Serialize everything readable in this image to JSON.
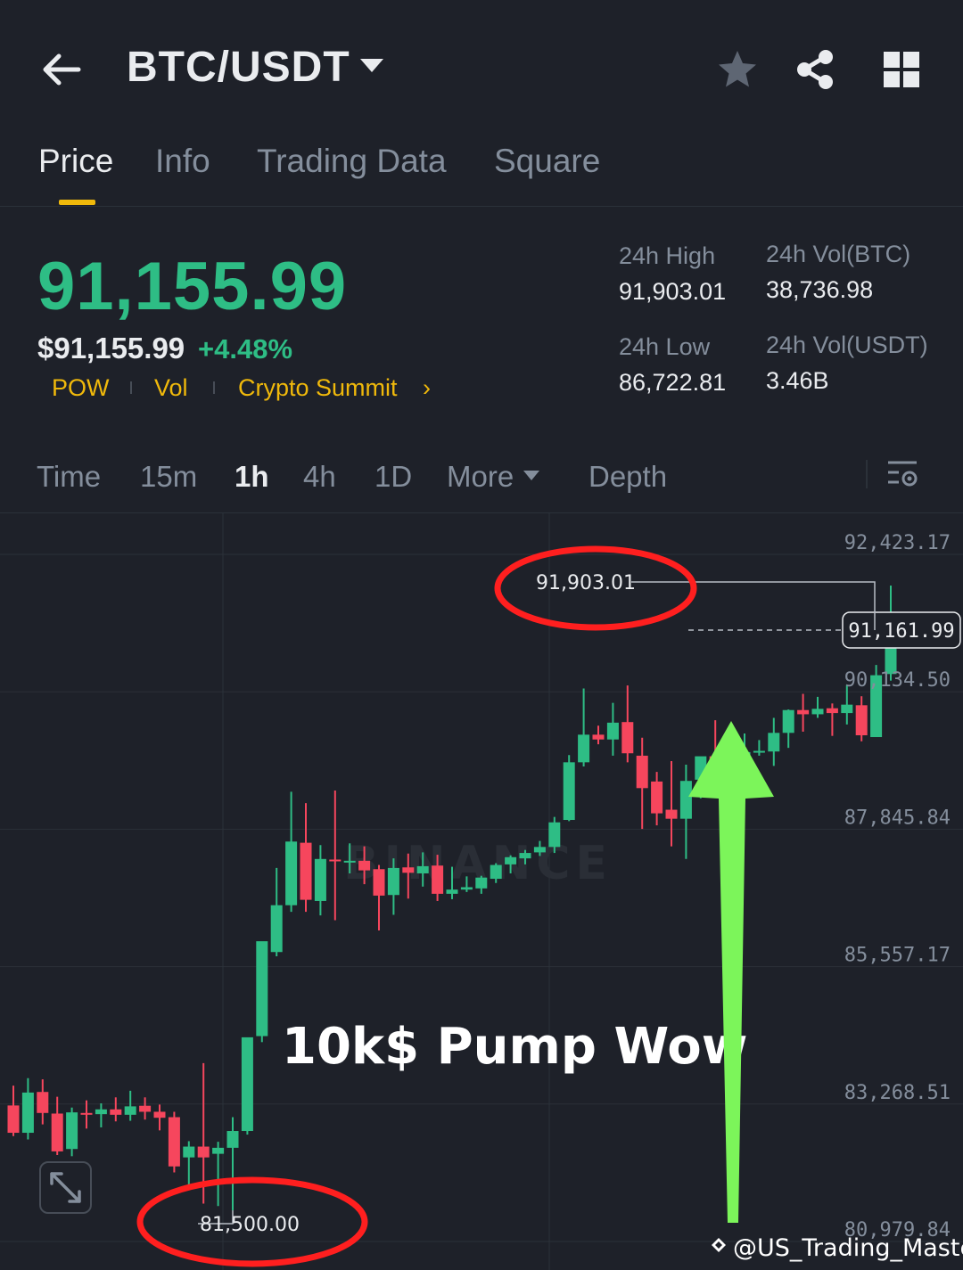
{
  "header": {
    "title": "BTC/USDT"
  },
  "tabs": [
    {
      "label": "Price",
      "active": true
    },
    {
      "label": "Info",
      "active": false
    },
    {
      "label": "Trading Data",
      "active": false
    },
    {
      "label": "Square",
      "active": false
    }
  ],
  "ticker": {
    "last_price": "91,155.99",
    "usd_price": "$91,155.99",
    "change_pct": "+4.48%",
    "tags": [
      "POW",
      "Vol",
      "Crypto Summit"
    ],
    "stats": {
      "high_label": "24h High",
      "high_value": "91,903.01",
      "low_label": "24h Low",
      "low_value": "86,722.81",
      "vol_btc_label": "24h Vol(BTC)",
      "vol_btc_value": "38,736.98",
      "vol_usdt_label": "24h Vol(USDT)",
      "vol_usdt_value": "3.46B"
    }
  },
  "intervals": {
    "items": [
      "Time",
      "15m",
      "1h",
      "4h",
      "1D"
    ],
    "active": "1h",
    "more_label": "More",
    "depth_label": "Depth"
  },
  "colors": {
    "up": "#2ebd85",
    "down": "#f6465d",
    "accent": "#f0b90b",
    "annotation_ring": "#ff1f1f",
    "arrow": "#7cf55a",
    "background": "#1e2129"
  },
  "icons": [
    "back-arrow-icon",
    "dropdown-caret-icon",
    "star-icon",
    "share-icon",
    "grid-icon",
    "chevron-right-icon",
    "chart-settings-icon",
    "expand-icon"
  ],
  "chart_data": {
    "type": "candlestick",
    "interval": "1h",
    "y_axis_ticks": [
      "92,423.17",
      "90,134.50",
      "87,845.84",
      "85,557.17",
      "83,268.51",
      "80,979.84"
    ],
    "ylim": [
      80979.84,
      92423.17
    ],
    "current_price_label": "91,161.99",
    "high_marker": "91,903.01",
    "low_marker": "81,500.00",
    "watermark": "BINANCE",
    "annotation_text": "10k$ Pump Wow",
    "credit": "@US_Trading_Master",
    "candles": [
      {
        "o": 83245,
        "h": 83575,
        "l": 82735,
        "c": 82790
      },
      {
        "o": 82790,
        "h": 83700,
        "l": 82680,
        "c": 83460
      },
      {
        "o": 83470,
        "h": 83680,
        "l": 82930,
        "c": 83120
      },
      {
        "o": 83110,
        "h": 83390,
        "l": 82420,
        "c": 82480
      },
      {
        "o": 82520,
        "h": 83210,
        "l": 82400,
        "c": 83130
      },
      {
        "o": 83120,
        "h": 83330,
        "l": 82860,
        "c": 83100
      },
      {
        "o": 83100,
        "h": 83280,
        "l": 82880,
        "c": 83180
      },
      {
        "o": 83180,
        "h": 83380,
        "l": 82980,
        "c": 83090
      },
      {
        "o": 83090,
        "h": 83490,
        "l": 82990,
        "c": 83230
      },
      {
        "o": 83240,
        "h": 83380,
        "l": 83010,
        "c": 83140
      },
      {
        "o": 83140,
        "h": 83260,
        "l": 82830,
        "c": 83040
      },
      {
        "o": 83050,
        "h": 83140,
        "l": 82130,
        "c": 82230
      },
      {
        "o": 82380,
        "h": 82650,
        "l": 81890,
        "c": 82560
      },
      {
        "o": 82560,
        "h": 83950,
        "l": 81610,
        "c": 82380
      },
      {
        "o": 82440,
        "h": 82640,
        "l": 81570,
        "c": 82540
      },
      {
        "o": 82540,
        "h": 83050,
        "l": 81500,
        "c": 82820
      },
      {
        "o": 82820,
        "h": 83200,
        "l": 82760,
        "c": 84380
      },
      {
        "o": 84400,
        "h": 84520,
        "l": 84300,
        "c": 85980
      },
      {
        "o": 85800,
        "h": 87200,
        "l": 85730,
        "c": 86580
      },
      {
        "o": 86580,
        "h": 88470,
        "l": 86470,
        "c": 87640
      },
      {
        "o": 87620,
        "h": 88280,
        "l": 86470,
        "c": 86670
      },
      {
        "o": 86650,
        "h": 87580,
        "l": 86410,
        "c": 87350
      },
      {
        "o": 87340,
        "h": 88490,
        "l": 86330,
        "c": 87310
      },
      {
        "o": 87310,
        "h": 87610,
        "l": 87110,
        "c": 87320
      },
      {
        "o": 87320,
        "h": 87560,
        "l": 86930,
        "c": 87160
      },
      {
        "o": 87180,
        "h": 87250,
        "l": 86160,
        "c": 86740
      },
      {
        "o": 86750,
        "h": 87360,
        "l": 86420,
        "c": 87200
      },
      {
        "o": 87210,
        "h": 87440,
        "l": 86690,
        "c": 87120
      },
      {
        "o": 87110,
        "h": 87460,
        "l": 86890,
        "c": 87230
      },
      {
        "o": 87240,
        "h": 87420,
        "l": 86650,
        "c": 86770
      },
      {
        "o": 86770,
        "h": 87220,
        "l": 86680,
        "c": 86840
      },
      {
        "o": 86840,
        "h": 87060,
        "l": 86800,
        "c": 86880
      },
      {
        "o": 86860,
        "h": 87070,
        "l": 86770,
        "c": 87040
      },
      {
        "o": 87020,
        "h": 87280,
        "l": 86950,
        "c": 87250
      },
      {
        "o": 87260,
        "h": 87410,
        "l": 87110,
        "c": 87380
      },
      {
        "o": 87360,
        "h": 87500,
        "l": 87260,
        "c": 87450
      },
      {
        "o": 87460,
        "h": 87650,
        "l": 87400,
        "c": 87550
      },
      {
        "o": 87550,
        "h": 88050,
        "l": 87450,
        "c": 87960
      },
      {
        "o": 88000,
        "h": 89080,
        "l": 87980,
        "c": 88960
      },
      {
        "o": 88960,
        "h": 90190,
        "l": 88890,
        "c": 89420
      },
      {
        "o": 89420,
        "h": 89570,
        "l": 89260,
        "c": 89340
      },
      {
        "o": 89340,
        "h": 89950,
        "l": 89070,
        "c": 89620
      },
      {
        "o": 89630,
        "h": 90240,
        "l": 88960,
        "c": 89110
      },
      {
        "o": 89070,
        "h": 89370,
        "l": 87850,
        "c": 88530
      },
      {
        "o": 88640,
        "h": 88800,
        "l": 87910,
        "c": 88110
      },
      {
        "o": 88170,
        "h": 88980,
        "l": 87560,
        "c": 88020
      },
      {
        "o": 88020,
        "h": 88920,
        "l": 87350,
        "c": 88650
      },
      {
        "o": 88670,
        "h": 88730,
        "l": 88360,
        "c": 89060
      },
      {
        "o": 89060,
        "h": 89660,
        "l": 88450,
        "c": 88680
      },
      {
        "o": 88650,
        "h": 89200,
        "l": 88320,
        "c": 89000
      },
      {
        "o": 88990,
        "h": 89440,
        "l": 88760,
        "c": 89130
      },
      {
        "o": 89130,
        "h": 89330,
        "l": 89070,
        "c": 89150
      },
      {
        "o": 89140,
        "h": 89700,
        "l": 88900,
        "c": 89450
      },
      {
        "o": 89450,
        "h": 89840,
        "l": 89200,
        "c": 89830
      },
      {
        "o": 89830,
        "h": 90100,
        "l": 89470,
        "c": 89760
      },
      {
        "o": 89760,
        "h": 90050,
        "l": 89700,
        "c": 89850
      },
      {
        "o": 89860,
        "h": 89940,
        "l": 89400,
        "c": 89780
      },
      {
        "o": 89780,
        "h": 90250,
        "l": 89590,
        "c": 89920
      },
      {
        "o": 89910,
        "h": 90060,
        "l": 89310,
        "c": 89410
      },
      {
        "o": 89380,
        "h": 90580,
        "l": 89380,
        "c": 90410
      },
      {
        "o": 90430,
        "h": 91903.01,
        "l": 90320,
        "c": 91160
      },
      {
        "o": 91120,
        "h": 91400,
        "l": 90980,
        "c": 91161.99
      }
    ]
  }
}
